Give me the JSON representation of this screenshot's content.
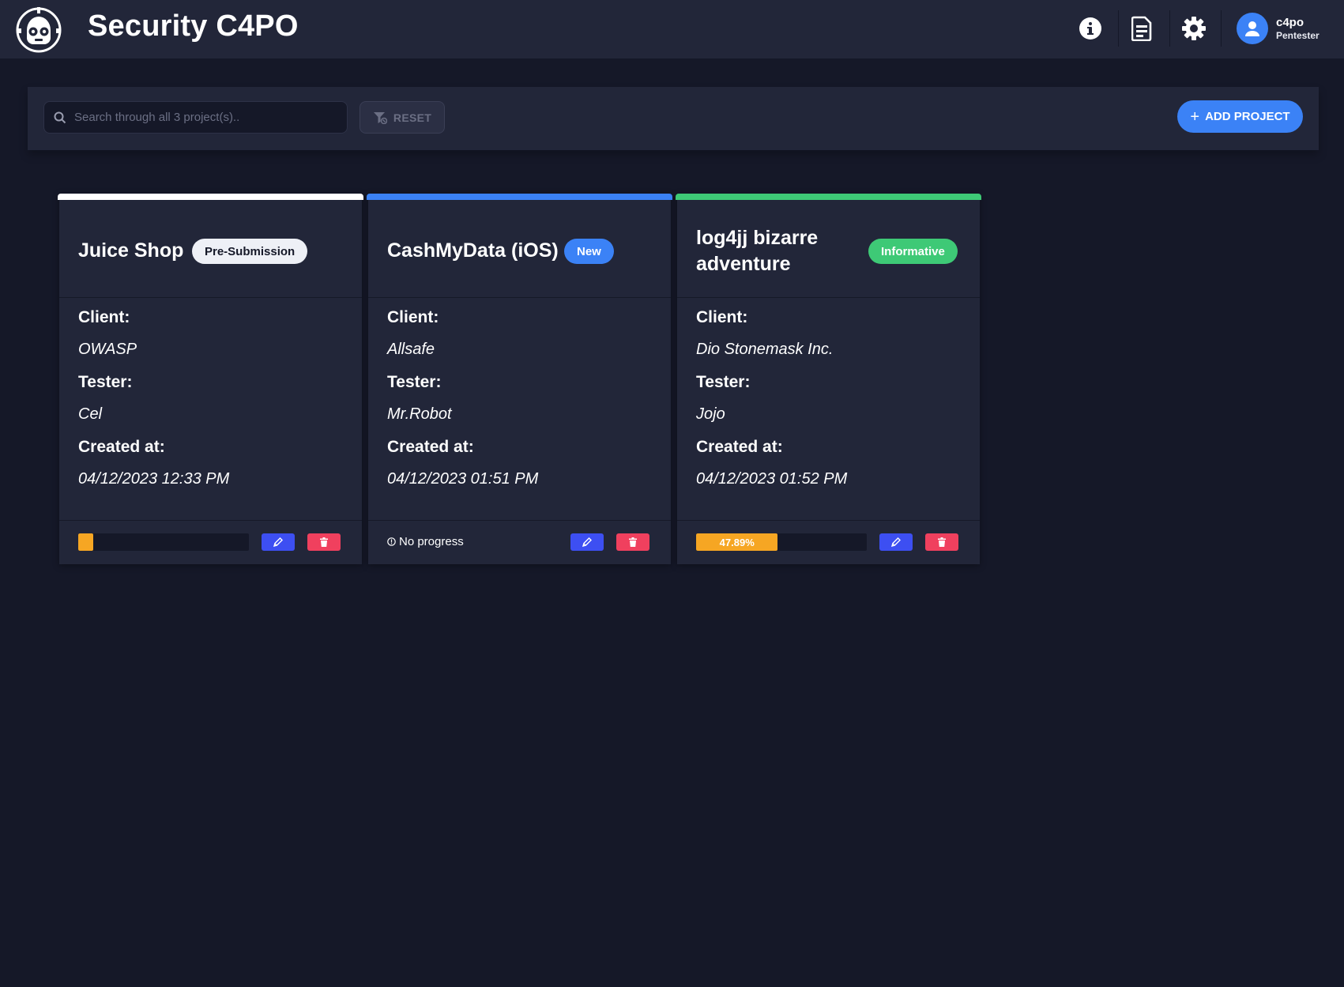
{
  "app": {
    "title": "Security C4PO"
  },
  "user": {
    "name": "c4po",
    "role": "Pentester"
  },
  "header_icons": [
    "info-icon",
    "report-icon",
    "settings-icon"
  ],
  "toolbar": {
    "search_placeholder": "Search through all 3 project(s)..",
    "reset_label": "RESET",
    "add_label": "ADD PROJECT",
    "add_plus": "+"
  },
  "labels": {
    "client": "Client:",
    "tester": "Tester:",
    "created": "Created at:",
    "no_progress": "No progress"
  },
  "projects": [
    {
      "title": "Juice Shop",
      "status": "Pre-Submission",
      "status_color": "#eef0f6",
      "accent_color": "#ffffff",
      "client": "OWASP",
      "tester": "Cel",
      "created": "04/12/2023 12:33 PM",
      "progress": 0.09,
      "progress_label": ""
    },
    {
      "title": "CashMyData (iOS)",
      "status": "New",
      "status_color": "#3b82f6",
      "accent_color": "#3b82f6",
      "client": "Allsafe",
      "tester": "Mr.Robot",
      "created": "04/12/2023 01:51 PM",
      "progress": null,
      "progress_label": ""
    },
    {
      "title": "log4jj bizarre adventure",
      "status": "Informative",
      "status_color": "#3ec976",
      "accent_color": "#3ec976",
      "client": "Dio Stonemask Inc.",
      "tester": "Jojo",
      "created": "04/12/2023 01:52 PM",
      "progress": 0.4789,
      "progress_label": "47.89%"
    }
  ],
  "colors": {
    "background": "#151828",
    "surface": "#222639",
    "primary": "#3b82f6",
    "edit": "#3d4ff2",
    "delete": "#f0405e",
    "progress": "#f6a623"
  }
}
